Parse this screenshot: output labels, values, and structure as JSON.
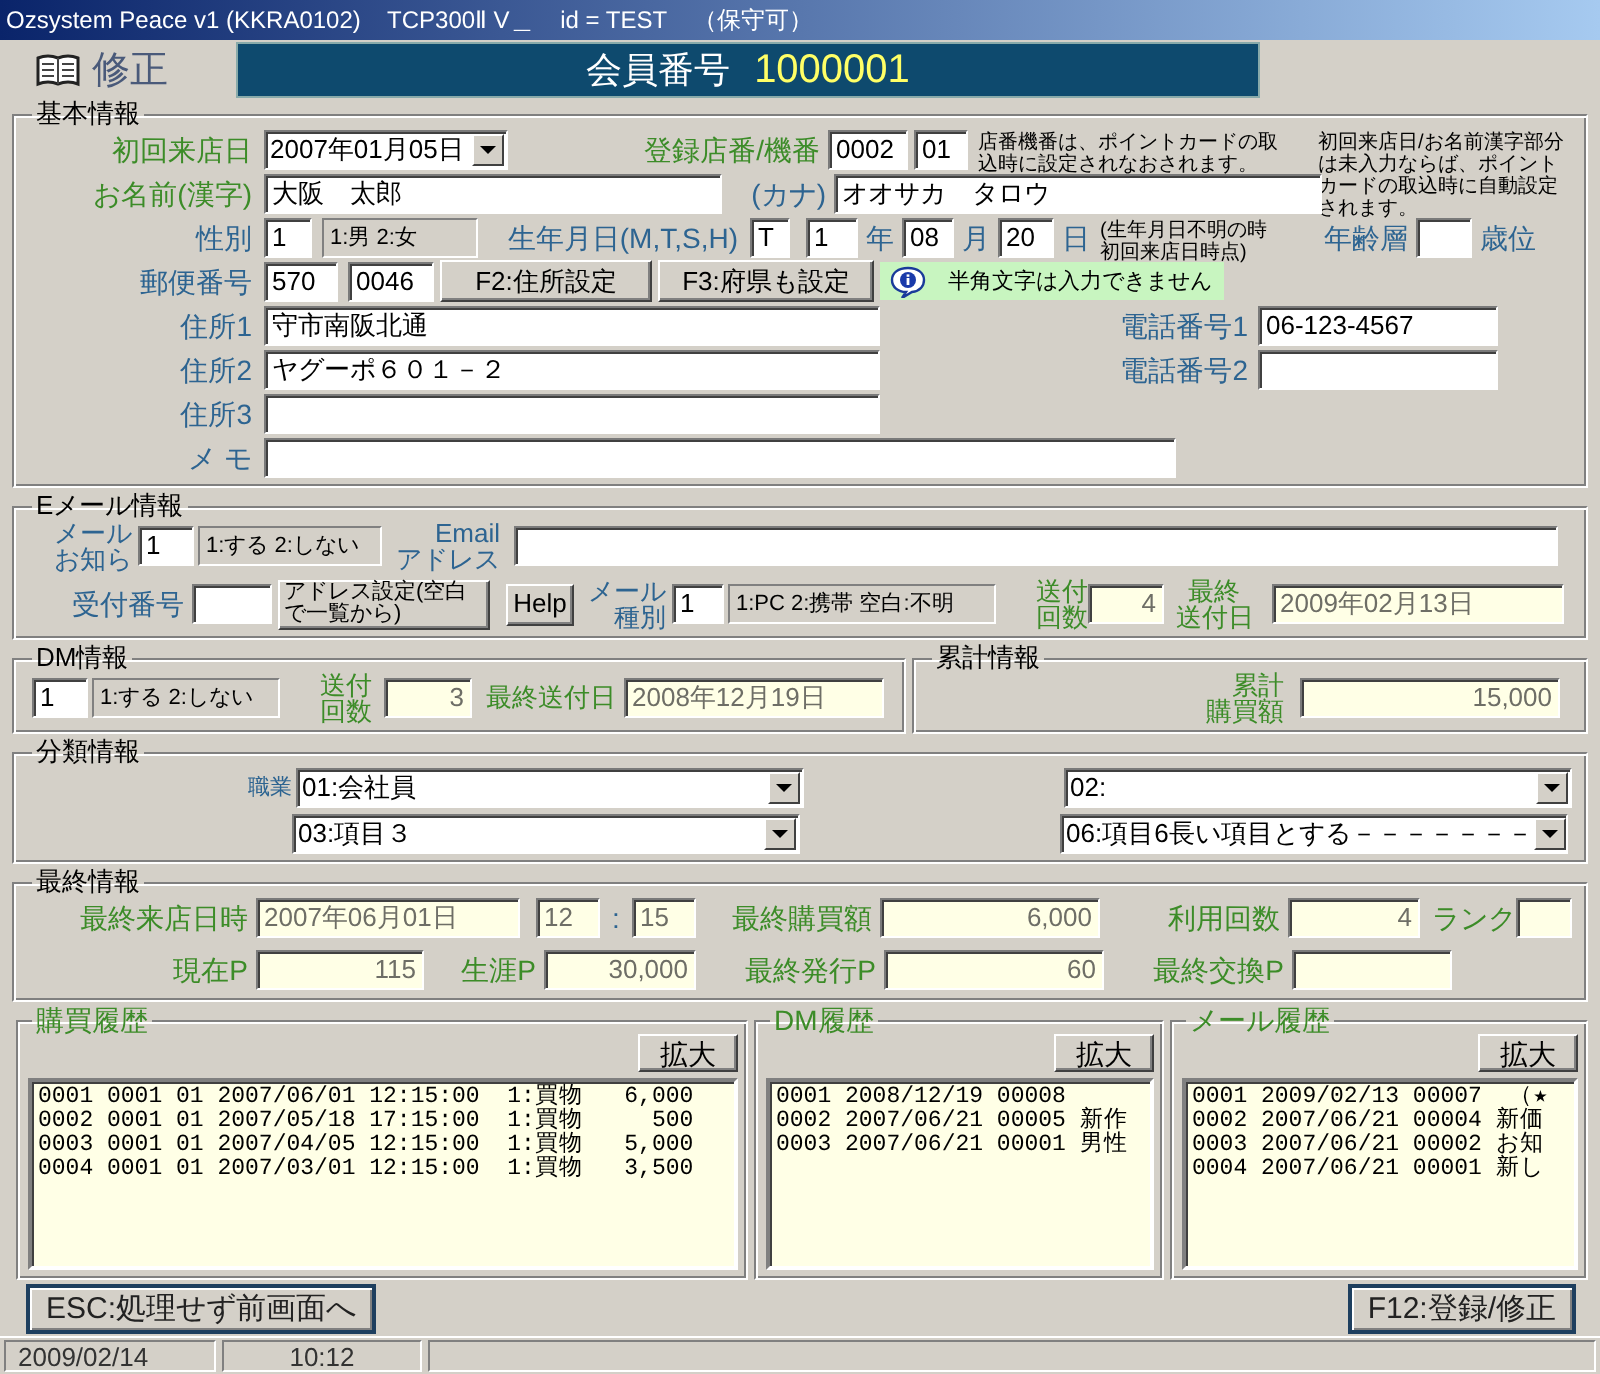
{
  "window": {
    "title": "Ozsystem Peace v1 (KKRA0102)    TCP300Ⅱ V＿    id = TEST    （保守可）"
  },
  "header": {
    "mode": "修正",
    "member_label": "会員番号",
    "member_no": "1000001"
  },
  "sections": [
    {
      "title": "基本情報",
      "lines": [
        {
          "items": [
            {
              "kind": "label",
              "text": "初回来店日",
              "color": "#3c8c28"
            },
            {
              "kind": "combo",
              "value": "2007年01月05日"
            },
            {
              "kind": "label",
              "text": "登録店番/機番",
              "color": "#3c8c28"
            },
            {
              "kind": "field",
              "value": "0002",
              "disabled": false
            },
            {
              "kind": "field",
              "value": "01",
              "disabled": false
            },
            {
              "kind": "note",
              "text": "店番機番は、ポイントカードの取込時に設定されなおされます。"
            },
            {
              "kind": "note",
              "text": "初回来店日/お名前漢字部分は未入力ならば、ポイントカードの取込時に自動設定されます。"
            }
          ]
        },
        {
          "items": [
            {
              "kind": "label",
              "text": "お名前(漢字)",
              "color": "#3c8c28"
            },
            {
              "kind": "field",
              "value": "大阪　太郎",
              "disabled": false
            },
            {
              "kind": "label",
              "text": "(カナ)",
              "color": "#2d6491"
            },
            {
              "kind": "field",
              "value": "オオサカ　タロウ",
              "disabled": false
            }
          ]
        },
        {
          "items": [
            {
              "kind": "label",
              "text": "性別",
              "color": "#2d6491"
            },
            {
              "kind": "field",
              "value": "1",
              "disabled": false
            },
            {
              "kind": "legend",
              "text": "1:男 2:女"
            },
            {
              "kind": "label",
              "text": "生年月日(M,T,S,H)",
              "color": "#2d6491"
            },
            {
              "kind": "field",
              "value": "T",
              "disabled": false
            },
            {
              "kind": "field",
              "value": "1",
              "disabled": false
            },
            {
              "kind": "label",
              "text": "年",
              "color": "#2d6491"
            },
            {
              "kind": "field",
              "value": "08",
              "disabled": false
            },
            {
              "kind": "label",
              "text": "月",
              "color": "#2d6491"
            },
            {
              "kind": "field",
              "value": "20",
              "disabled": false
            },
            {
              "kind": "label",
              "text": "日",
              "color": "#2d6491"
            },
            {
              "kind": "note",
              "text": "(生年月日不明の時初回来店日時点)"
            },
            {
              "kind": "label",
              "text": "年齢層",
              "color": "#2d6491"
            },
            {
              "kind": "field",
              "disabled": false
            },
            {
              "kind": "label",
              "text": "歳位",
              "color": "#2d6491"
            }
          ]
        },
        {
          "items": [
            {
              "kind": "label",
              "text": "郵便番号",
              "color": "#2d6491"
            },
            {
              "kind": "field",
              "value": "570",
              "disabled": false
            },
            {
              "kind": "field",
              "value": "0046",
              "disabled": false
            },
            {
              "kind": "button",
              "label": "F2:住所設定"
            },
            {
              "kind": "button",
              "label": "F3:府県も設定"
            },
            {
              "kind": "info",
              "text": "半角文字は入力できません"
            }
          ]
        },
        {
          "items": [
            {
              "kind": "label",
              "text": "住所1",
              "color": "#2d6491"
            },
            {
              "kind": "field",
              "value": "守市南阪北通",
              "disabled": false
            },
            {
              "kind": "label",
              "text": "電話番号1",
              "color": "#2d6491"
            },
            {
              "kind": "field",
              "value": "06-123-4567",
              "disabled": false
            }
          ]
        },
        {
          "items": [
            {
              "kind": "label",
              "text": "住所2",
              "color": "#2d6491"
            },
            {
              "kind": "field",
              "value": "ヤグーポ６０１－２",
              "disabled": false
            },
            {
              "kind": "label",
              "text": "電話番号2",
              "color": "#2d6491"
            },
            {
              "kind": "field",
              "disabled": false
            }
          ]
        },
        {
          "items": [
            {
              "kind": "label",
              "text": "住所3",
              "color": "#2d6491"
            },
            {
              "kind": "field",
              "disabled": false
            }
          ]
        },
        {
          "items": [
            {
              "kind": "label",
              "text": "メ モ",
              "color": "#2d6491"
            },
            {
              "kind": "field",
              "disabled": false
            }
          ]
        }
      ]
    },
    {
      "title": "Eメール情報",
      "lines": [
        {
          "items": [
            {
              "kind": "label",
              "text": "メールお知ら",
              "color": "#2d6491"
            },
            {
              "kind": "field",
              "value": "1",
              "disabled": false
            },
            {
              "kind": "legend",
              "text": "1:する 2:しない"
            },
            {
              "kind": "label",
              "text": "Emailアドレス",
              "color": "#2d6491"
            },
            {
              "kind": "field",
              "disabled": false
            }
          ]
        },
        {
          "items": [
            {
              "kind": "label",
              "text": "受付番号",
              "color": "#2d6491"
            },
            {
              "kind": "field",
              "disabled": false
            },
            {
              "kind": "button",
              "label": "アドレス設定(空白で一覧から)"
            },
            {
              "kind": "button",
              "label": "Help"
            },
            {
              "kind": "label",
              "text": "メール種別",
              "color": "#2d6491"
            },
            {
              "kind": "field",
              "value": "1",
              "disabled": false
            },
            {
              "kind": "legend",
              "text": "1:PC 2:携帯 空白:不明"
            },
            {
              "kind": "label",
              "text": "送付回数",
              "color": "#3c8c28"
            },
            {
              "kind": "field",
              "value": "4",
              "disabled": true
            },
            {
              "kind": "label",
              "text": "最終送付日",
              "color": "#3c8c28"
            },
            {
              "kind": "field",
              "value": "2009年02月13日",
              "disabled": true
            }
          ]
        }
      ]
    },
    {
      "title": "DM情報",
      "lines": [
        {
          "items": [
            {
              "kind": "field",
              "value": "1",
              "disabled": false
            },
            {
              "kind": "legend",
              "text": "1:する 2:しない"
            },
            {
              "kind": "label",
              "text": "送付回数",
              "color": "#3c8c28"
            },
            {
              "kind": "field",
              "value": "3",
              "disabled": true
            },
            {
              "kind": "label",
              "text": "最終送付日",
              "color": "#3c8c28"
            },
            {
              "kind": "field",
              "value": "2008年12月19日",
              "disabled": true
            }
          ]
        }
      ]
    },
    {
      "title": "累計情報",
      "lines": [
        {
          "items": [
            {
              "kind": "label",
              "text": "累計購買額",
              "color": "#3c8c28"
            },
            {
              "kind": "field",
              "value": "15,000",
              "disabled": true
            }
          ]
        }
      ]
    },
    {
      "title": "分類情報",
      "lines": [
        {
          "items": [
            {
              "kind": "label",
              "text": "職業",
              "color": "#2d6491"
            },
            {
              "kind": "combo",
              "value": "01:会社員"
            },
            {
              "kind": "combo",
              "value": "02:"
            }
          ]
        },
        {
          "items": [
            {
              "kind": "combo",
              "value": "03:項目３"
            },
            {
              "kind": "combo",
              "value": "06:項目6長い項目とする－－－－－－－"
            }
          ]
        }
      ]
    },
    {
      "title": "最終情報",
      "lines": [
        {
          "items": [
            {
              "kind": "label",
              "text": "最終来店日時",
              "color": "#3c8c28"
            },
            {
              "kind": "field",
              "value": "2007年06月01日",
              "disabled": true
            },
            {
              "kind": "field",
              "value": "12",
              "disabled": true
            },
            {
              "kind": "label",
              "text": ":",
              "color": "#2d6491"
            },
            {
              "kind": "field",
              "value": "15",
              "disabled": true
            },
            {
              "kind": "label",
              "text": "最終購買額",
              "color": "#3c8c28"
            },
            {
              "kind": "field",
              "value": "6,000",
              "disabled": true
            },
            {
              "kind": "label",
              "text": "利用回数",
              "color": "#3c8c28"
            },
            {
              "kind": "field",
              "value": "4",
              "disabled": true
            },
            {
              "kind": "label",
              "text": "ランク",
              "color": "#3c8c28"
            },
            {
              "kind": "field",
              "disabled": true
            }
          ]
        },
        {
          "items": [
            {
              "kind": "label",
              "text": "現在P",
              "color": "#3c8c28"
            },
            {
              "kind": "field",
              "value": "115",
              "disabled": true
            },
            {
              "kind": "label",
              "text": "生涯P",
              "color": "#3c8c28"
            },
            {
              "kind": "field",
              "value": "30,000",
              "disabled": true
            },
            {
              "kind": "label",
              "text": "最終発行P",
              "color": "#3c8c28"
            },
            {
              "kind": "field",
              "value": "60",
              "disabled": true
            },
            {
              "kind": "label",
              "text": "最終交換P",
              "color": "#3c8c28"
            },
            {
              "kind": "field",
              "disabled": true
            }
          ]
        }
      ]
    }
  ],
  "histories": [
    {
      "title": "購買履歴",
      "button": "拡大",
      "rows": [
        "0001 0001 01 2007/06/01 12:15:00  1:買物   6,000",
        "0002 0001 01 2007/05/18 17:15:00  1:買物     500",
        "0003 0001 01 2007/04/05 12:15:00  1:買物   5,000",
        "0004 0001 01 2007/03/01 12:15:00  1:買物   3,500"
      ]
    },
    {
      "title": "DM履歴",
      "button": "拡大",
      "rows": [
        "0001 2008/12/19 00008",
        "0002 2007/06/21 00005 新作",
        "0003 2007/06/21 00001 男性"
      ]
    },
    {
      "title": "メール履歴",
      "button": "拡大",
      "rows": [
        "0001 2009/02/13 00007  （★",
        "0002 2007/06/21 00004 新価",
        "0003 2007/06/21 00002 お知",
        "0004 2007/06/21 00001 新し"
      ]
    }
  ],
  "actions": [
    {
      "label": "ESC:処理せず前画面へ"
    },
    {
      "label": "F12:登録/修正"
    }
  ],
  "status_bar": [
    "2009/02/14",
    "10:12"
  ]
}
